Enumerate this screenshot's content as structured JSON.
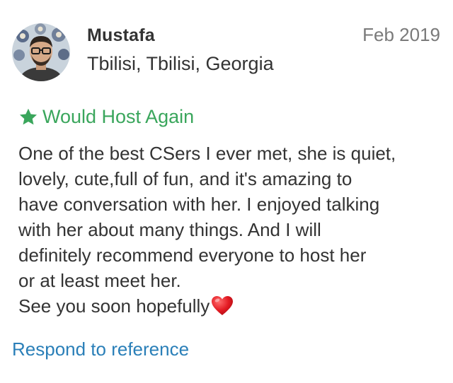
{
  "author": {
    "name": "Mustafa",
    "location": "Tbilisi, Tbilisi, Georgia",
    "avatar_icon": "profile-avatar"
  },
  "reference": {
    "date": "Feb 2019",
    "badge_icon": "star-icon",
    "badge_label": "Would Host Again",
    "badge_color": "#3aa65c",
    "body_lines": [
      "One of the best CSers I ever met, she is quiet,",
      "lovely, cute,full of fun, and it's amazing to",
      "have conversation with her. I enjoyed talking",
      "with her about many things. And I will",
      "definitely recommend everyone to host her",
      "or at least meet her.",
      "See you soon hopefully"
    ],
    "closing_icon": "heart-icon"
  },
  "actions": {
    "respond_label": "Respond to reference",
    "link_color": "#2a7fb8"
  }
}
